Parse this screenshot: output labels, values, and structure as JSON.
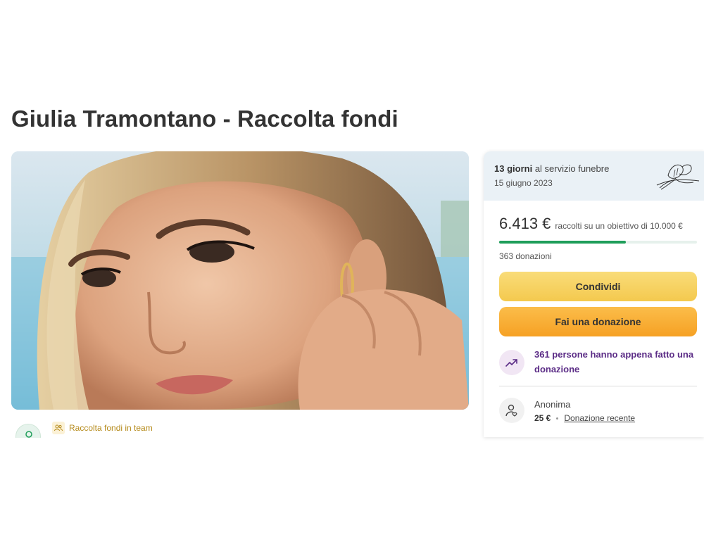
{
  "campaign": {
    "title": "Giulia Tramontano - Raccolta fondi",
    "team_tag": "Raccolta fondi in team"
  },
  "service": {
    "days": "13 giorni",
    "label": "al servizio funebre",
    "date": "15 giugno 2023"
  },
  "progress": {
    "raised": "6.413 €",
    "goal_text": "raccolti su un obiettivo di 10.000 €",
    "fraction": 0.6413,
    "donations": "363 donazioni"
  },
  "buttons": {
    "share": "Condividi",
    "donate": "Fai una donazione"
  },
  "recent": {
    "text": "361 persone hanno appena fatto una donazione"
  },
  "donor": {
    "name": "Anonima",
    "amount": "25 €",
    "link": "Donazione recente"
  },
  "colors": {
    "progress_fill": "#1f9e5a",
    "share_button": "#f4c94e",
    "donate_button": "#f6a124",
    "recent_text": "#5b2c86"
  }
}
